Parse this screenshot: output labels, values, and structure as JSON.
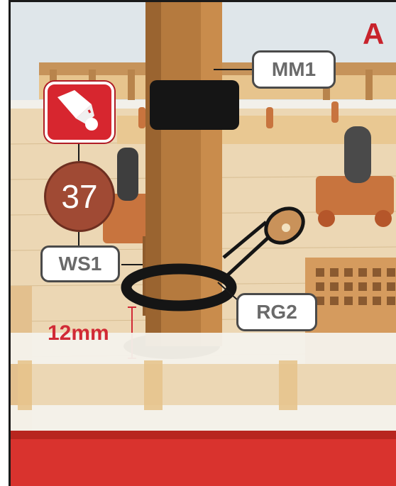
{
  "panel": {
    "letter": "A"
  },
  "callouts": {
    "main_mast": "MM1",
    "wood_strip": "WS1",
    "rigging_ring": "RG2"
  },
  "step": {
    "number": "37"
  },
  "measurement": {
    "text": "12mm"
  },
  "icons": {
    "glue": "glue-bottle-icon"
  },
  "colors": {
    "accent_red": "#c8232c",
    "badge_brown": "#a04a34",
    "callout_text": "#6a6a6a"
  }
}
